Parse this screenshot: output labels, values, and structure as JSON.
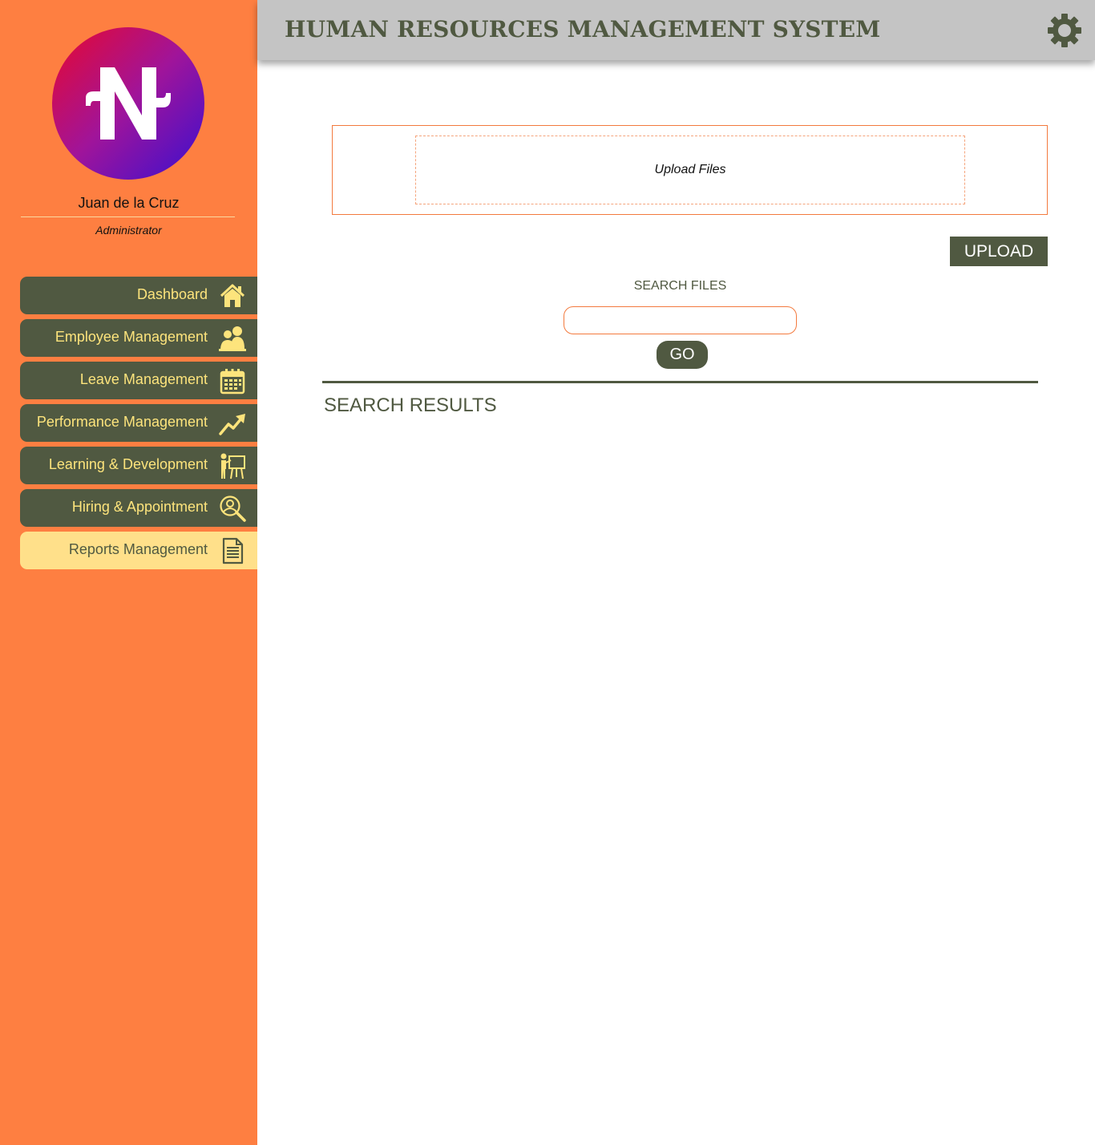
{
  "header": {
    "title": "HUMAN RESOURCES MANAGEMENT SYSTEM",
    "settings_icon": "gear-icon"
  },
  "user": {
    "name": "Juan de la Cruz",
    "role": "Administrator",
    "avatar_icon": "n-logo-icon"
  },
  "sidebar": {
    "items": [
      {
        "label": "Dashboard",
        "icon": "home-icon",
        "active": false
      },
      {
        "label": "Employee Management",
        "icon": "people-icon",
        "active": false
      },
      {
        "label": "Leave Management",
        "icon": "calendar-icon",
        "active": false
      },
      {
        "label": "Performance Management",
        "icon": "trend-up-icon",
        "active": false
      },
      {
        "label": "Learning & Development",
        "icon": "presentation-icon",
        "active": false
      },
      {
        "label": "Hiring & Appointment",
        "icon": "user-search-icon",
        "active": false
      },
      {
        "label": "Reports Management",
        "icon": "document-icon",
        "active": true
      }
    ]
  },
  "upload": {
    "drop_label": "Upload Files",
    "button_label": "UPLOAD"
  },
  "search": {
    "label": "SEARCH FILES",
    "value": "",
    "go_label": "GO"
  },
  "results": {
    "title": "SEARCH RESULTS"
  },
  "colors": {
    "sidebar": "#fe7f41",
    "nav_bg": "#505941",
    "nav_text": "#fde47c",
    "nav_active_bg": "#ffe08a",
    "header_bg": "#c4c4c4",
    "accent": "#f37a3e"
  }
}
